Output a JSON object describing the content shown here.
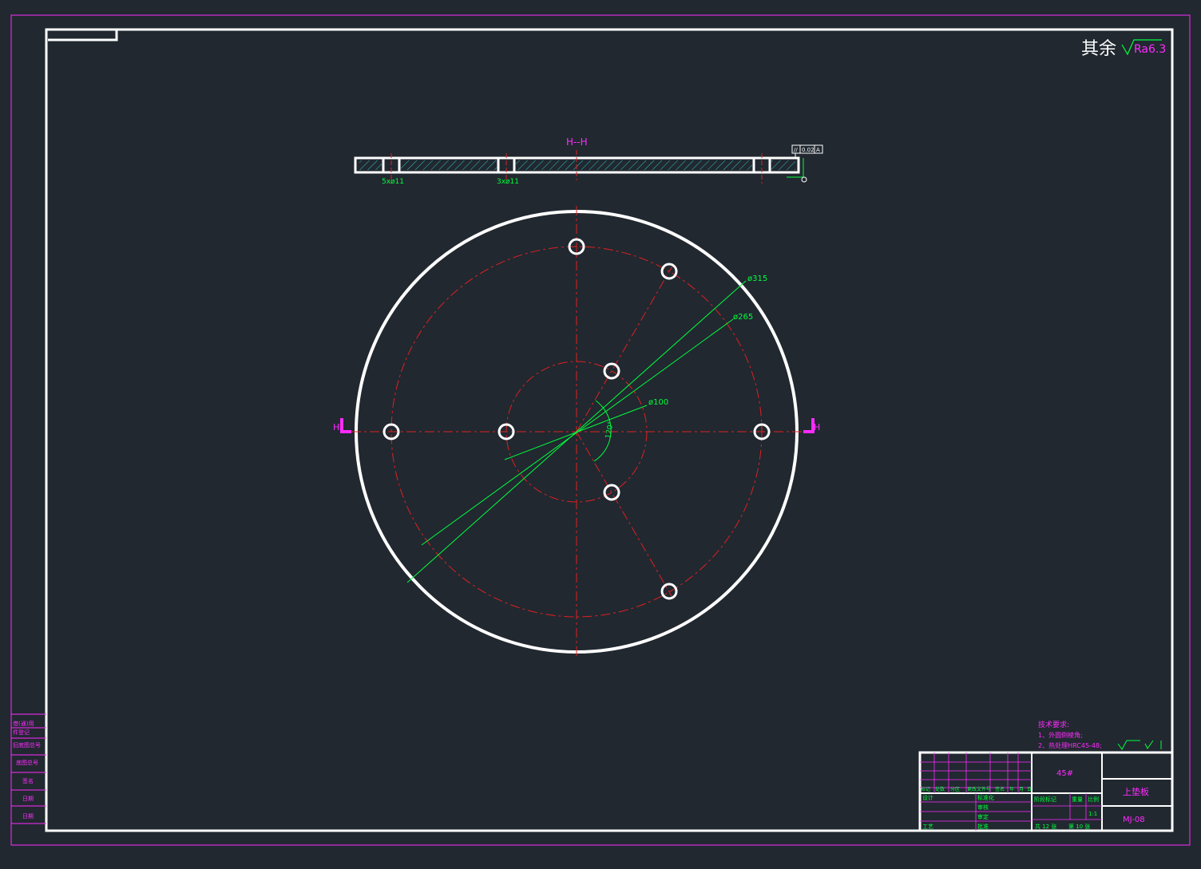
{
  "surface_roughness": {
    "label": "其余",
    "value": "Ra6.3"
  },
  "section_title": "H--H",
  "section_markers": {
    "left": "H",
    "right": "H"
  },
  "hole_callouts": {
    "left": "5xø11",
    "middle": "3xø11"
  },
  "tolerance_frame": {
    "symbol": "//",
    "value": "0.02",
    "datum": "A"
  },
  "dimensions": {
    "d315": "ø315",
    "d265": "ø265",
    "d100": "ø100",
    "angle": "120°"
  },
  "tech_requirements": {
    "title": "技术要求:",
    "line1": "1、外圆倒棱角;",
    "line2": "2、热处理HRC45-48;"
  },
  "title_block": {
    "material": "45#",
    "part_name": "上垫板",
    "drawing_no": "MJ-08",
    "scale": "1:1",
    "sheet_total": "共 12 张",
    "sheet_no": "第 10 张",
    "rev_headers": [
      "标记",
      "处数",
      "分区",
      "更改文件号",
      "签名",
      "年",
      "月",
      "日"
    ],
    "role_labels": [
      "设计",
      "标准化",
      "审核",
      "审定",
      "工艺",
      "批准"
    ],
    "stage_headers": [
      "阶段标记",
      "重量",
      "比例"
    ]
  },
  "side_stamp": [
    "借(通)用",
    "件登记",
    "旧底图总号",
    "底图总号",
    "签名",
    "日期",
    "日期"
  ]
}
